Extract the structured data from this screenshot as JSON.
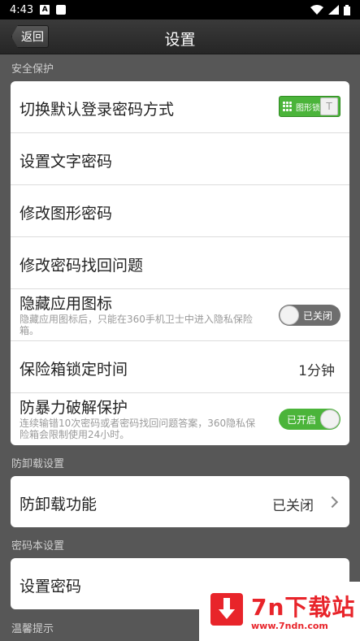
{
  "status_bar": {
    "time": "4:43",
    "notif_letter": "A"
  },
  "header": {
    "back_label": "返回",
    "title": "设置"
  },
  "sections": {
    "security": {
      "label": "安全保护",
      "rows": {
        "switch_login": {
          "title": "切换默认登录密码方式",
          "toggle_label": "图形锁",
          "toggle_box": "T"
        },
        "text_password": {
          "title": "设置文字密码"
        },
        "pattern_password": {
          "title": "修改图形密码"
        },
        "recovery_question": {
          "title": "修改密码找回问题"
        },
        "hide_icon": {
          "title": "隐藏应用图标",
          "subtitle": "隐藏应用图标后，只能在360手机卫士中进入隐私保险箱。",
          "toggle_label": "已关闭",
          "toggle_state": "off"
        },
        "lock_time": {
          "title": "保险箱锁定时间",
          "value": "1分钟"
        },
        "brute_force": {
          "title": "防暴力破解保护",
          "subtitle": "连续输错10次密码或者密码找回问题答案，360隐私保险箱会限制使用24小时。",
          "toggle_label": "已开启",
          "toggle_state": "on"
        }
      }
    },
    "uninstall": {
      "label": "防卸载设置",
      "rows": {
        "anti_uninstall": {
          "title": "防卸载功能",
          "value": "已关闭"
        }
      }
    },
    "notebook": {
      "label": "密码本设置",
      "rows": {
        "set_password": {
          "title": "设置密码"
        }
      }
    },
    "tips": {
      "label": "温馨提示"
    }
  },
  "watermark": {
    "brand": "7n下载站",
    "url": "www.7ndn.com"
  },
  "colors": {
    "toggle_on": "#4bb43a",
    "toggle_off": "#6e6e6e",
    "watermark": "#e8242a"
  }
}
